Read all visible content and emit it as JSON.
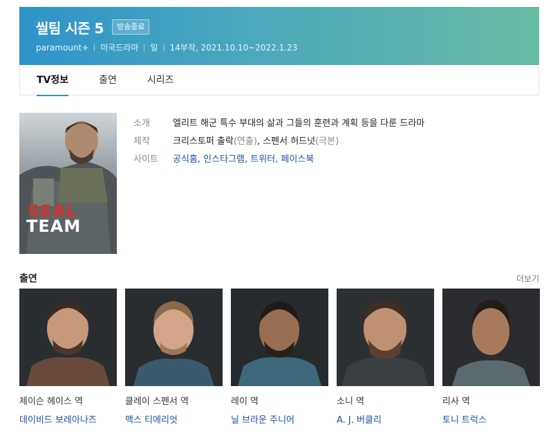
{
  "header": {
    "title": "씰팀 시즌 5",
    "badge": "방송종료",
    "meta": [
      "paramount+",
      "미국드라마",
      "일",
      "14부작, 2021.10.10~2022.1.23"
    ]
  },
  "tabs": [
    {
      "label": "TV정보",
      "active": true
    },
    {
      "label": "출연",
      "active": false
    },
    {
      "label": "시리즈",
      "active": false
    }
  ],
  "poster": {
    "line1": "SEAL",
    "line2": "TEAM"
  },
  "info": {
    "intro_label": "소개",
    "intro_value": "엘리트 해군 특수 부대의 삶과 그들의 훈련과 계획 등을 다룬 드라마",
    "production_label": "제작",
    "production_name1": "크리스토퍼 출락",
    "production_role1": "(연출)",
    "production_sep": ", ",
    "production_name2": "스펜서 허드넛",
    "production_role2": "(극본)",
    "site_label": "사이트",
    "sites": [
      "공식홈",
      "인스타그램",
      "트위터",
      "페이스북"
    ]
  },
  "cast_section": {
    "title": "출연",
    "more": "더보기"
  },
  "cast": [
    {
      "role": "제이슨 헤이스 역",
      "actor": "데이비드 보레아나즈"
    },
    {
      "role": "클레이 스펜서 역",
      "actor": "맥스 티에리엇"
    },
    {
      "role": "레이 역",
      "actor": "닐 브라운 주니어"
    },
    {
      "role": "소니 역",
      "actor": "A. J. 버클리"
    },
    {
      "role": "리사 역",
      "actor": "토니 트럭스"
    }
  ],
  "colors": {
    "accent": "#2e8fc7",
    "link": "#1c4fa3",
    "header_start": "#2e93c9",
    "header_end": "#69bca3"
  }
}
